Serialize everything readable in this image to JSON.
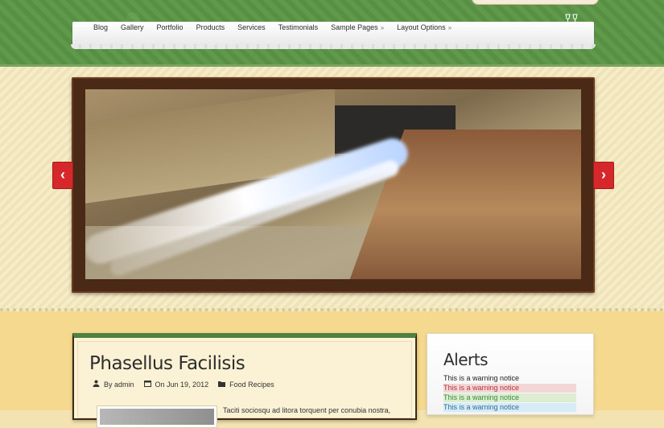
{
  "nav": {
    "items": [
      {
        "label": "Blog",
        "has_submenu": false
      },
      {
        "label": "Gallery",
        "has_submenu": false
      },
      {
        "label": "Portfolio",
        "has_submenu": false
      },
      {
        "label": "Products",
        "has_submenu": false
      },
      {
        "label": "Services",
        "has_submenu": false
      },
      {
        "label": "Testimonials",
        "has_submenu": false
      },
      {
        "label": "Sample Pages",
        "has_submenu": true
      },
      {
        "label": "Layout Options",
        "has_submenu": true
      }
    ],
    "submenu_indicator": "»"
  },
  "slider": {
    "prev_arrow": "‹",
    "next_arrow": "›"
  },
  "post": {
    "title": "Phasellus Facilisis",
    "author": "By admin",
    "date": "On Jun 19, 2012",
    "category": "Food Recipes",
    "excerpt": "Taciti sociosqu ad litora torquent per conubia nostra,"
  },
  "sidebar": {
    "title": "Alerts",
    "alerts": [
      {
        "text": "This is a warning notice",
        "color": "#222222"
      },
      {
        "text": "This is a warning notice",
        "color": "#b8333b"
      },
      {
        "text": "This is a warning notice",
        "color": "#3a8a3a"
      },
      {
        "text": "This is a warning notice",
        "color": "#2a6f9c"
      }
    ]
  },
  "colors": {
    "header_green": "#5f9a4a",
    "accent_red": "#d6272b",
    "frame_brown": "#4a2a17"
  }
}
